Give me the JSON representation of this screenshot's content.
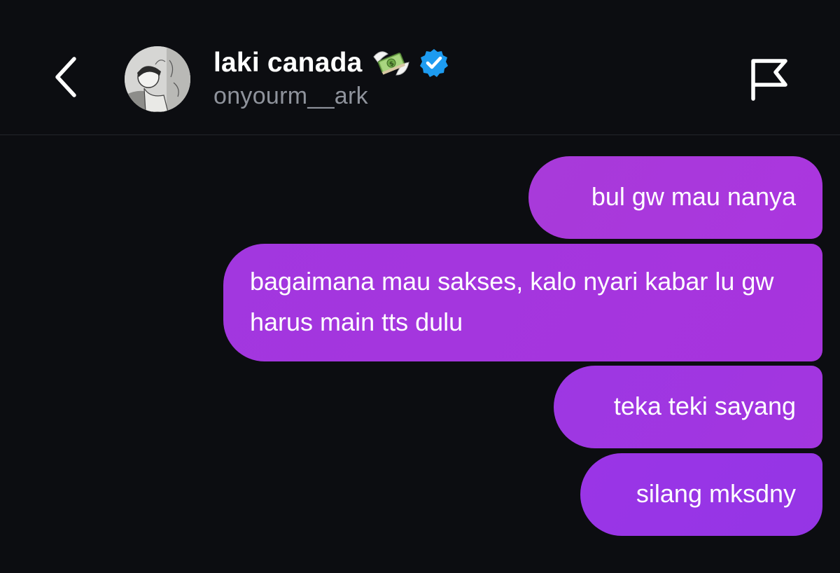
{
  "header": {
    "display_name": "laki canada",
    "username": "onyourm__ark",
    "name_emoji": "money-with-wings-emoji",
    "badge": "verified-badge-icon",
    "back_icon": "chevron-left-icon",
    "report_icon": "flag-icon"
  },
  "colors": {
    "background": "#0c0d11",
    "bubble": "#a336df",
    "verified": "#1d9bf0",
    "secondary_text": "#8f939c"
  },
  "messages": [
    {
      "text": "bul gw mau nanya",
      "from": "me"
    },
    {
      "text": "bagaimana mau sakses, kalo nyari kabar lu gw harus main tts dulu",
      "from": "me"
    },
    {
      "text": "teka teki sayang",
      "from": "me"
    },
    {
      "text": "silang mksdny",
      "from": "me"
    }
  ]
}
